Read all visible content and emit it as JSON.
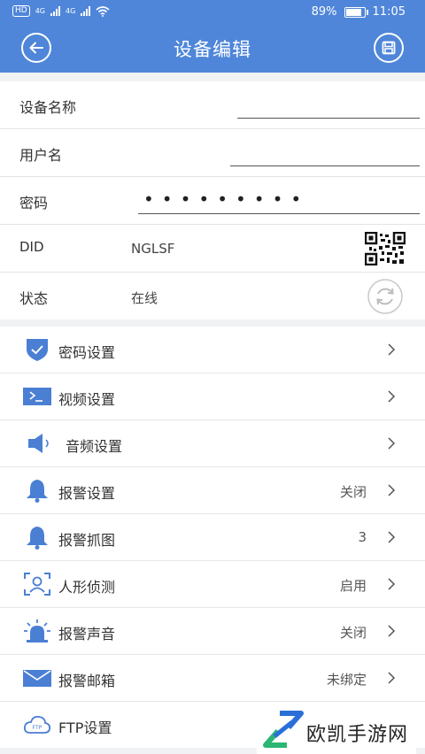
{
  "status_bar": {
    "chip": "HD",
    "network1": "4G",
    "network2": "4G",
    "battery": "89%",
    "time": "11:05"
  },
  "header": {
    "title": "设备编辑"
  },
  "form": {
    "device_name_label": "设备名称",
    "username_label": "用户名",
    "password_label": "密码",
    "password_value": "•••••••••",
    "did_label": "DID",
    "did_value": "NGLSF",
    "status_label": "状态",
    "status_value": "在线"
  },
  "menu": [
    {
      "label": "密码设置",
      "value": "",
      "icon": "shield-icon"
    },
    {
      "label": "视频设置",
      "value": "",
      "icon": "video-icon"
    },
    {
      "label": "音频设置",
      "value": "",
      "icon": "speaker-icon"
    },
    {
      "label": "报警设置",
      "value": "关闭",
      "icon": "bell-icon"
    },
    {
      "label": "报警抓图",
      "value": "3",
      "icon": "bell-icon"
    },
    {
      "label": "人形侦测",
      "value": "启用",
      "icon": "person-detect-icon"
    },
    {
      "label": "报警声音",
      "value": "关闭",
      "icon": "siren-icon"
    },
    {
      "label": "报警邮箱",
      "value": "未绑定",
      "icon": "mail-icon"
    },
    {
      "label": "FTP设置",
      "value": "",
      "icon": "cloud-ftp-icon"
    }
  ],
  "watermark": {
    "text": "欧凯手游网"
  },
  "colors": {
    "primary": "#4f86d9",
    "icon_blue": "#4a7fd4"
  }
}
